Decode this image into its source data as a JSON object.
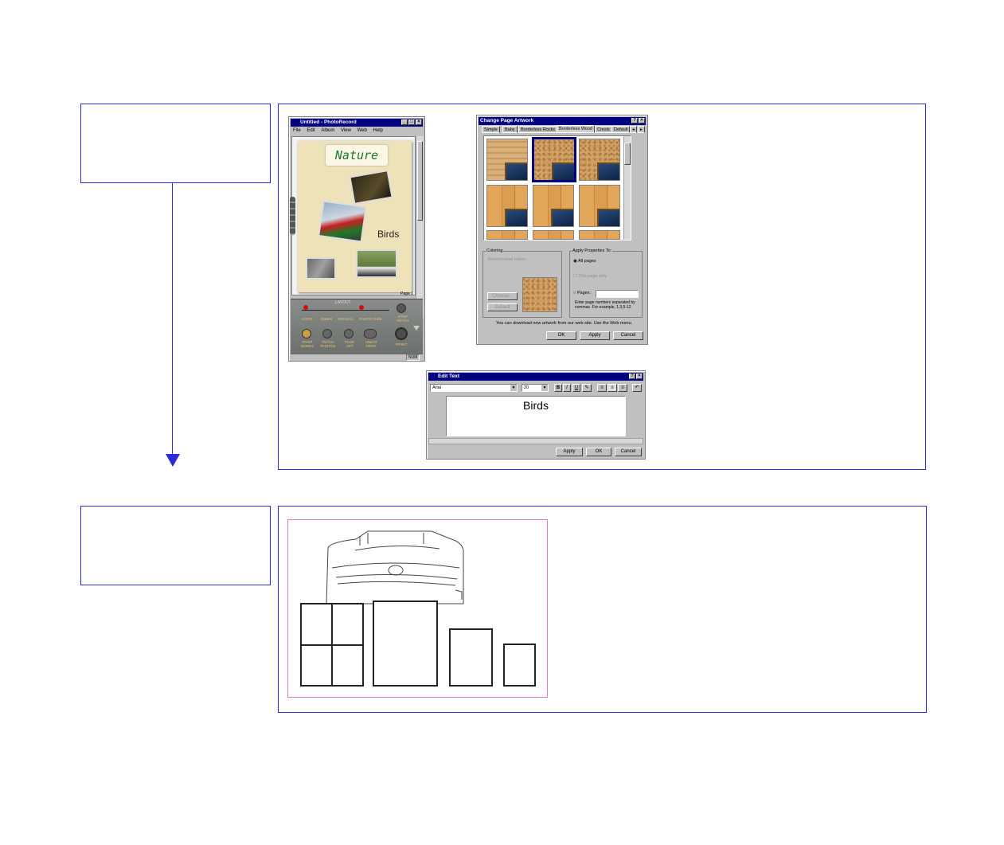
{
  "photorecord": {
    "title": "Untitled - PhotoRecord",
    "menus": [
      "File",
      "Edit",
      "Album",
      "View",
      "Web",
      "Help"
    ],
    "page_title": "Nature",
    "page_caption": "Birds",
    "page_indicator": "Page 1",
    "layout_label": "LAYOUT",
    "layout_options": [
      "AUTO",
      "INDEX",
      "MANUAL",
      "PHOTO SIZE"
    ],
    "stop_fetch": "STOP FETCH",
    "tools": [
      "PRINT MODES",
      "FETCH PHOTOS",
      "PAGE ART",
      "UNDO/ REDO"
    ],
    "print_label": "PRINT",
    "status": "NUM"
  },
  "change_artwork": {
    "title": "Change Page Artwork",
    "tabs": [
      "Simple",
      "Baby",
      "Borderless Rocks",
      "Borderless Wood",
      "Crests",
      "Default"
    ],
    "coloring_label": "Coloring",
    "recommended": "Recommend colors",
    "choose_btn": "Choose...",
    "default_btn": "Default",
    "apply_to_label": "Apply Properties To:",
    "all_pages": "All pages",
    "this_page": "This page only",
    "pages_label": "Pages:",
    "pages_hint": "Enter page numbers separated by commas. For example, 1,3,5-12",
    "download_note": "You can download new artwork from our web site. Use the Web menu.",
    "ok": "OK",
    "apply": "Apply",
    "cancel": "Cancel"
  },
  "edit_text": {
    "title": "Edit Text",
    "font": "Arial",
    "size": "20",
    "format_buttons": [
      "B",
      "I",
      "U"
    ],
    "content": "Birds",
    "apply": "Apply",
    "ok": "OK",
    "cancel": "Cancel"
  },
  "colors": {
    "frame_blue": "#2b2bd8",
    "title_navy": "#000080",
    "pink_border": "#e07ad0"
  }
}
